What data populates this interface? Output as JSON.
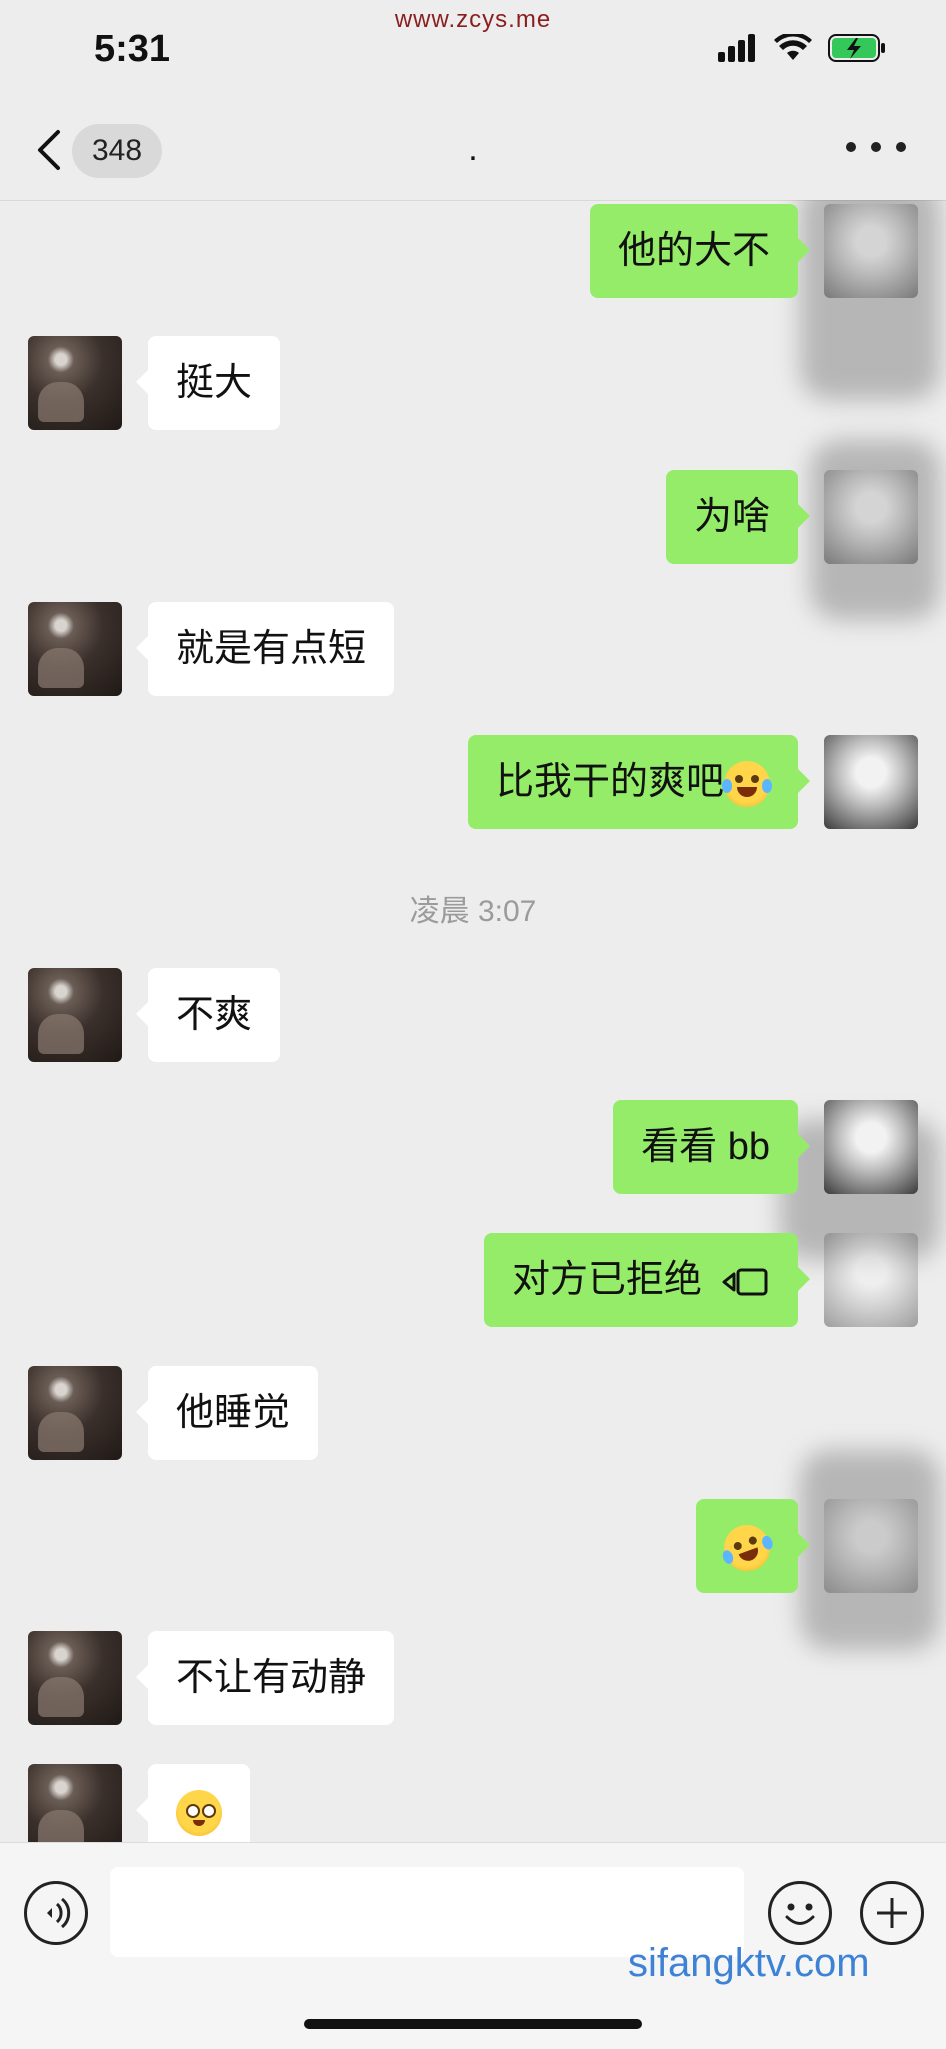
{
  "status_bar": {
    "time": "5:31",
    "watermark": "www.zcys.me"
  },
  "nav": {
    "unread_count": "348",
    "title": "."
  },
  "messages": [
    {
      "side": "out",
      "text": "他的大不"
    },
    {
      "side": "in",
      "text": "挺大"
    },
    {
      "side": "out",
      "text": "为啥"
    },
    {
      "side": "in",
      "text": "就是有点短"
    },
    {
      "side": "out",
      "text": "比我干的爽吧",
      "emoji": "tears-of-joy-emoji"
    },
    {
      "side": "in",
      "text": "不爽"
    },
    {
      "side": "out",
      "text": "看看 bb"
    },
    {
      "side": "out",
      "text": "对方已拒绝",
      "icon": "video-call-icon"
    },
    {
      "side": "in",
      "text": "他睡觉"
    },
    {
      "side": "out",
      "emoji": "rolling-laughing-emoji"
    },
    {
      "side": "in",
      "text": "不让有动静"
    },
    {
      "side": "in",
      "emoji": "flushed-emoji"
    }
  ],
  "timestamp": "凌晨 3:07",
  "input_bar": {
    "watermark": "sifangktv.com"
  }
}
